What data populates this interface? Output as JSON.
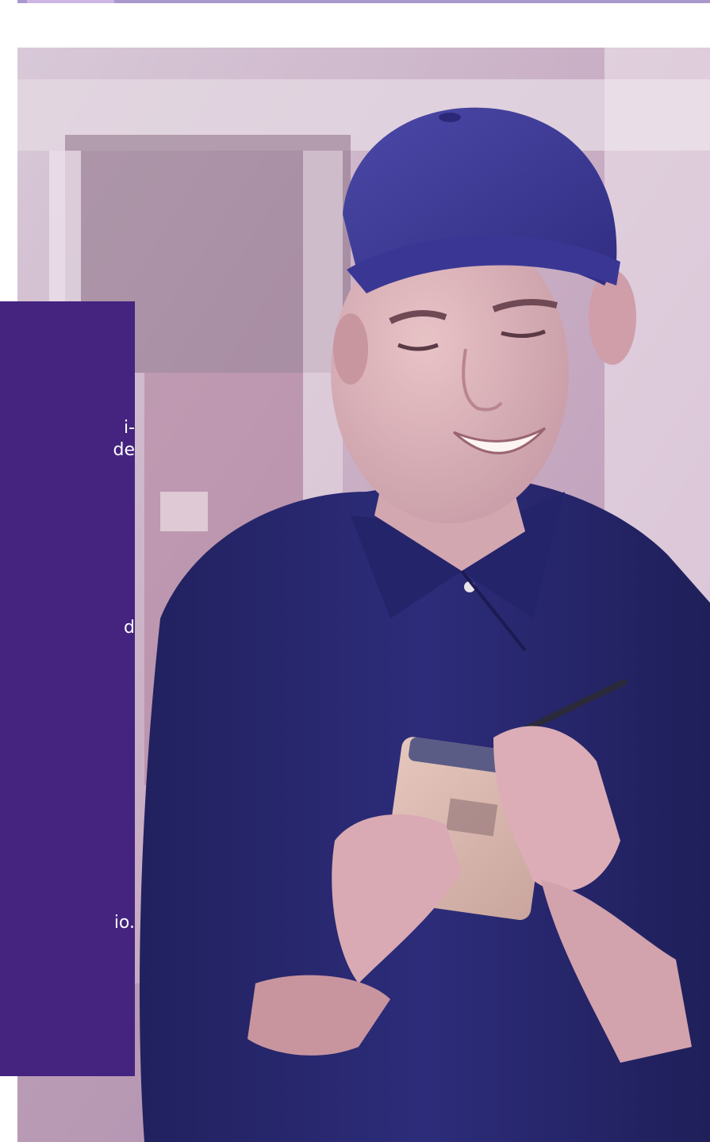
{
  "panel": {
    "fragments": [
      "i-",
      "de",
      "d",
      "io."
    ],
    "color": "#44247f"
  },
  "photo": {
    "subject": "delivery-worker-with-handheld-device",
    "cap_color": "#3b3896",
    "shirt_color": "#272771",
    "tint": "#c09fbf"
  }
}
